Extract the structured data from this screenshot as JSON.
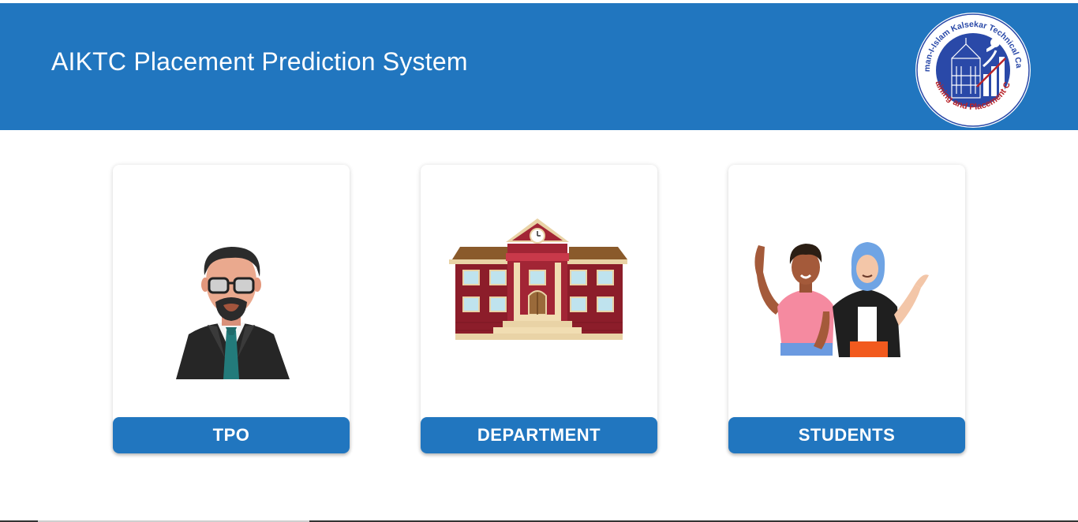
{
  "header": {
    "title": "AIKTC Placement Prediction System",
    "logo": {
      "text_top": "Anjuman-I-Islam Kalsekar Technical Campus",
      "text_bottom": "Training and Placement Cell"
    }
  },
  "cards": [
    {
      "id": "tpo",
      "label": "TPO",
      "illustration": "tpo-person-icon"
    },
    {
      "id": "department",
      "label": "DEPARTMENT",
      "illustration": "building-icon"
    },
    {
      "id": "students",
      "label": "STUDENTS",
      "illustration": "students-icon"
    }
  ],
  "colors": {
    "header_bg": "#2176bf",
    "button_bg": "#2176bf",
    "logo_ring": "#b8242a",
    "logo_inner": "#2a49a8"
  }
}
